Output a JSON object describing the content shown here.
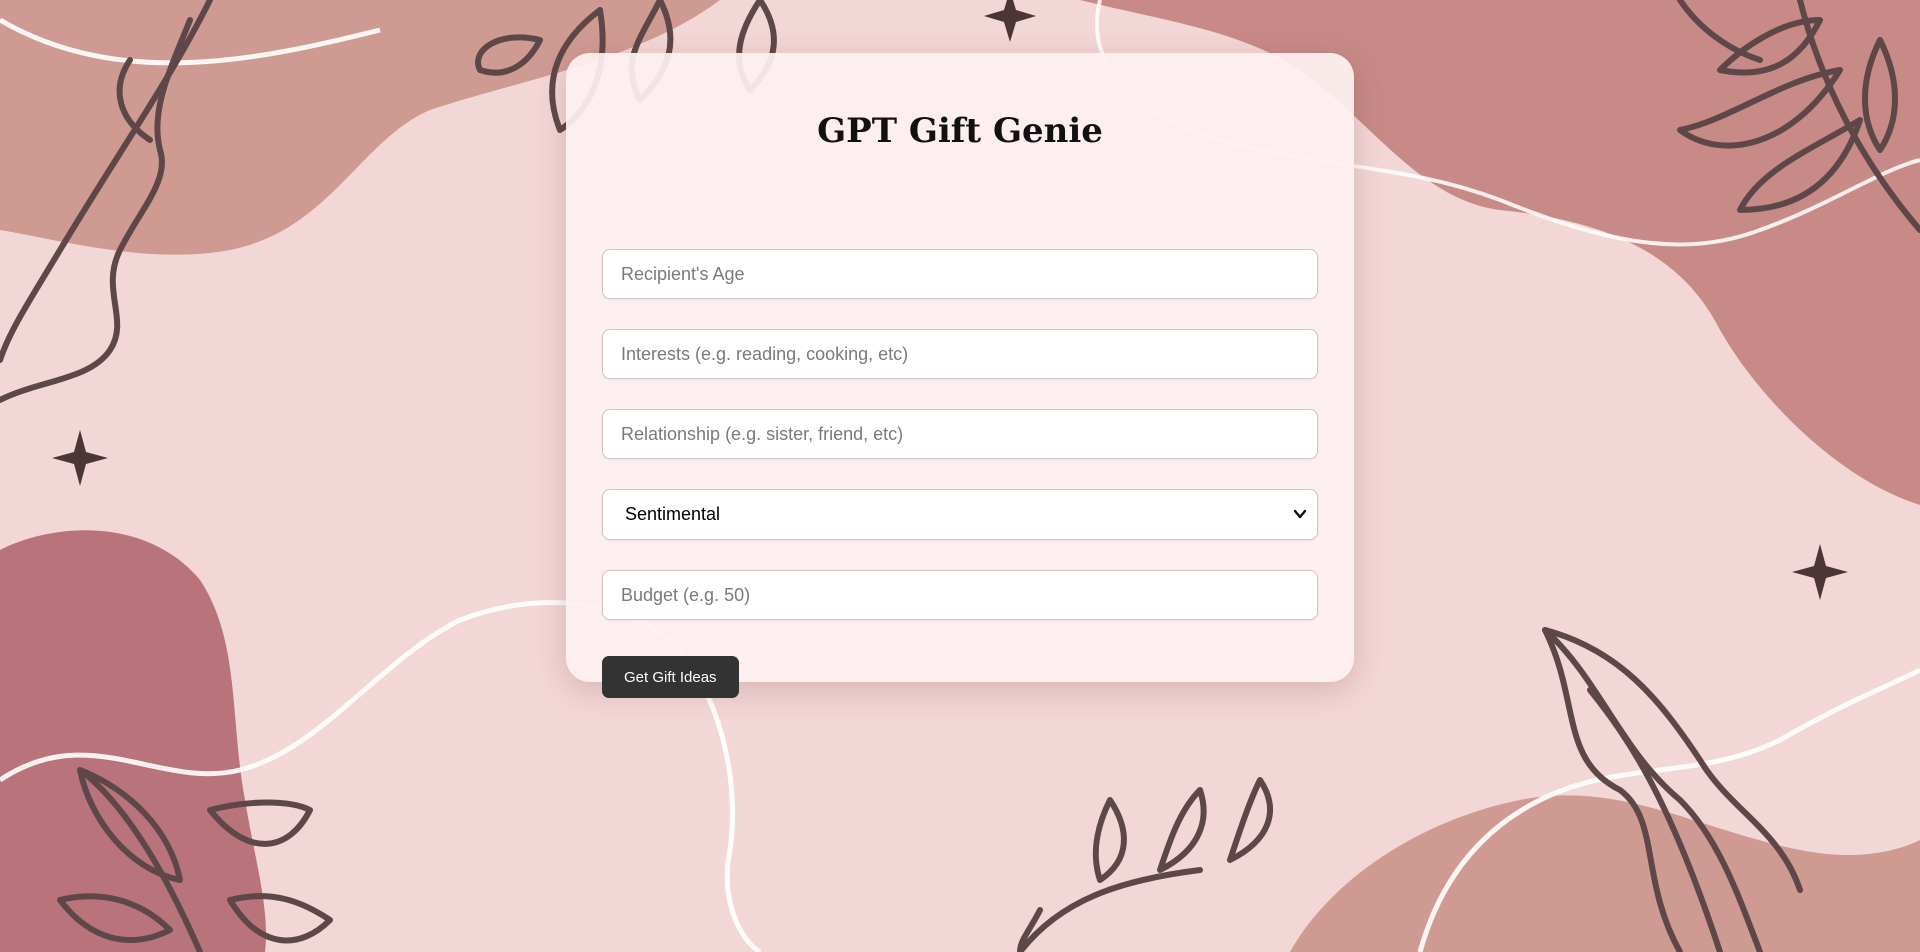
{
  "page": {
    "title": "GPT Gift Genie"
  },
  "form": {
    "age": {
      "placeholder": "Recipient's Age",
      "value": ""
    },
    "interests": {
      "placeholder": "Interests (e.g. reading, cooking, etc)",
      "value": ""
    },
    "relationship": {
      "placeholder": "Relationship (e.g. sister, friend, etc)",
      "value": ""
    },
    "gift_type": {
      "selected": "Sentimental"
    },
    "budget": {
      "placeholder": "Budget (e.g. 50)",
      "value": ""
    },
    "submit_label": "Get Gift Ideas"
  },
  "colors": {
    "background_light": "#f3d6d6",
    "blob_dusty_rose": "#c88a86",
    "blob_tan": "#cf9a92",
    "blob_deep_rose": "#b8737b",
    "line_art": "#5e4748",
    "card": "#fdf0f1",
    "button": "#333333"
  },
  "icons": {
    "select_arrow": "chevron-down-icon",
    "sparkles": "sparkle-icon",
    "leaves": "leaf-branch-icon"
  }
}
